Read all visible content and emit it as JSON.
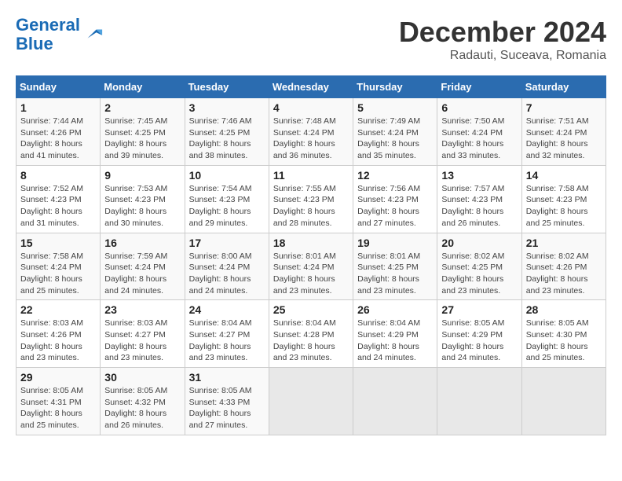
{
  "logo": {
    "line1": "General",
    "line2": "Blue"
  },
  "title": "December 2024",
  "subtitle": "Radauti, Suceava, Romania",
  "days_header": [
    "Sunday",
    "Monday",
    "Tuesday",
    "Wednesday",
    "Thursday",
    "Friday",
    "Saturday"
  ],
  "weeks": [
    [
      {
        "day": "1",
        "info": "Sunrise: 7:44 AM\nSunset: 4:26 PM\nDaylight: 8 hours\nand 41 minutes."
      },
      {
        "day": "2",
        "info": "Sunrise: 7:45 AM\nSunset: 4:25 PM\nDaylight: 8 hours\nand 39 minutes."
      },
      {
        "day": "3",
        "info": "Sunrise: 7:46 AM\nSunset: 4:25 PM\nDaylight: 8 hours\nand 38 minutes."
      },
      {
        "day": "4",
        "info": "Sunrise: 7:48 AM\nSunset: 4:24 PM\nDaylight: 8 hours\nand 36 minutes."
      },
      {
        "day": "5",
        "info": "Sunrise: 7:49 AM\nSunset: 4:24 PM\nDaylight: 8 hours\nand 35 minutes."
      },
      {
        "day": "6",
        "info": "Sunrise: 7:50 AM\nSunset: 4:24 PM\nDaylight: 8 hours\nand 33 minutes."
      },
      {
        "day": "7",
        "info": "Sunrise: 7:51 AM\nSunset: 4:24 PM\nDaylight: 8 hours\nand 32 minutes."
      }
    ],
    [
      {
        "day": "8",
        "info": "Sunrise: 7:52 AM\nSunset: 4:23 PM\nDaylight: 8 hours\nand 31 minutes."
      },
      {
        "day": "9",
        "info": "Sunrise: 7:53 AM\nSunset: 4:23 PM\nDaylight: 8 hours\nand 30 minutes."
      },
      {
        "day": "10",
        "info": "Sunrise: 7:54 AM\nSunset: 4:23 PM\nDaylight: 8 hours\nand 29 minutes."
      },
      {
        "day": "11",
        "info": "Sunrise: 7:55 AM\nSunset: 4:23 PM\nDaylight: 8 hours\nand 28 minutes."
      },
      {
        "day": "12",
        "info": "Sunrise: 7:56 AM\nSunset: 4:23 PM\nDaylight: 8 hours\nand 27 minutes."
      },
      {
        "day": "13",
        "info": "Sunrise: 7:57 AM\nSunset: 4:23 PM\nDaylight: 8 hours\nand 26 minutes."
      },
      {
        "day": "14",
        "info": "Sunrise: 7:58 AM\nSunset: 4:23 PM\nDaylight: 8 hours\nand 25 minutes."
      }
    ],
    [
      {
        "day": "15",
        "info": "Sunrise: 7:58 AM\nSunset: 4:24 PM\nDaylight: 8 hours\nand 25 minutes."
      },
      {
        "day": "16",
        "info": "Sunrise: 7:59 AM\nSunset: 4:24 PM\nDaylight: 8 hours\nand 24 minutes."
      },
      {
        "day": "17",
        "info": "Sunrise: 8:00 AM\nSunset: 4:24 PM\nDaylight: 8 hours\nand 24 minutes."
      },
      {
        "day": "18",
        "info": "Sunrise: 8:01 AM\nSunset: 4:24 PM\nDaylight: 8 hours\nand 23 minutes."
      },
      {
        "day": "19",
        "info": "Sunrise: 8:01 AM\nSunset: 4:25 PM\nDaylight: 8 hours\nand 23 minutes."
      },
      {
        "day": "20",
        "info": "Sunrise: 8:02 AM\nSunset: 4:25 PM\nDaylight: 8 hours\nand 23 minutes."
      },
      {
        "day": "21",
        "info": "Sunrise: 8:02 AM\nSunset: 4:26 PM\nDaylight: 8 hours\nand 23 minutes."
      }
    ],
    [
      {
        "day": "22",
        "info": "Sunrise: 8:03 AM\nSunset: 4:26 PM\nDaylight: 8 hours\nand 23 minutes."
      },
      {
        "day": "23",
        "info": "Sunrise: 8:03 AM\nSunset: 4:27 PM\nDaylight: 8 hours\nand 23 minutes."
      },
      {
        "day": "24",
        "info": "Sunrise: 8:04 AM\nSunset: 4:27 PM\nDaylight: 8 hours\nand 23 minutes."
      },
      {
        "day": "25",
        "info": "Sunrise: 8:04 AM\nSunset: 4:28 PM\nDaylight: 8 hours\nand 23 minutes."
      },
      {
        "day": "26",
        "info": "Sunrise: 8:04 AM\nSunset: 4:29 PM\nDaylight: 8 hours\nand 24 minutes."
      },
      {
        "day": "27",
        "info": "Sunrise: 8:05 AM\nSunset: 4:29 PM\nDaylight: 8 hours\nand 24 minutes."
      },
      {
        "day": "28",
        "info": "Sunrise: 8:05 AM\nSunset: 4:30 PM\nDaylight: 8 hours\nand 25 minutes."
      }
    ],
    [
      {
        "day": "29",
        "info": "Sunrise: 8:05 AM\nSunset: 4:31 PM\nDaylight: 8 hours\nand 25 minutes."
      },
      {
        "day": "30",
        "info": "Sunrise: 8:05 AM\nSunset: 4:32 PM\nDaylight: 8 hours\nand 26 minutes."
      },
      {
        "day": "31",
        "info": "Sunrise: 8:05 AM\nSunset: 4:33 PM\nDaylight: 8 hours\nand 27 minutes."
      },
      {
        "day": "",
        "info": ""
      },
      {
        "day": "",
        "info": ""
      },
      {
        "day": "",
        "info": ""
      },
      {
        "day": "",
        "info": ""
      }
    ]
  ]
}
